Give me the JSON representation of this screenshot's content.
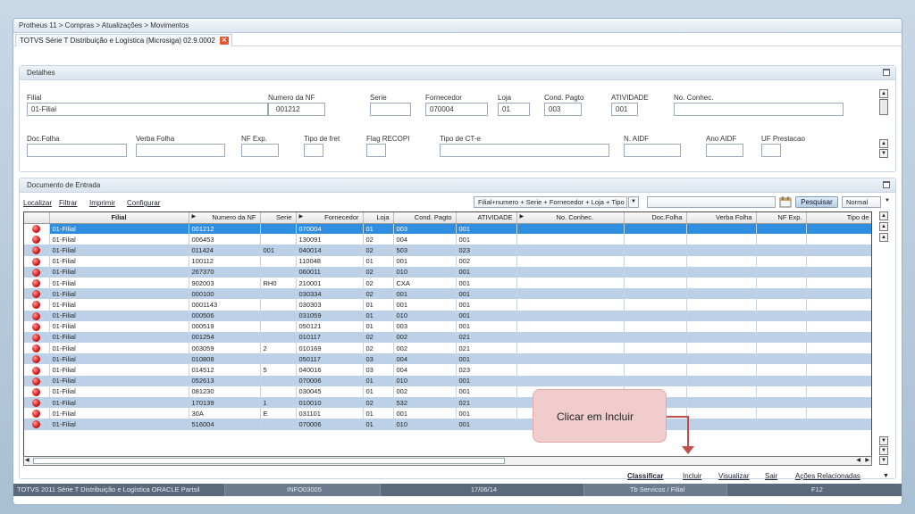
{
  "breadcrumb": "Protheus 11 > Compras  > Atualizações > Movimentos",
  "tab": {
    "label": "TOTVS Série T Distribuição e Logística (Microsiga) 02.9.0002",
    "close": "✕"
  },
  "detalhes": {
    "title": "Detalhes",
    "fields": {
      "filial": {
        "label": "Filial",
        "value": "01-Filial"
      },
      "numero_nf": {
        "label": "Numero da NF",
        "value": "001212"
      },
      "serie": {
        "label": "Serie",
        "value": ""
      },
      "fornecedor": {
        "label": "Fornecedor",
        "value": "070004"
      },
      "loja": {
        "label": "Loja",
        "value": "01"
      },
      "cond_pagto": {
        "label": "Cond. Pagto",
        "value": "003"
      },
      "atividade": {
        "label": "ATIVIDADE",
        "value": "001"
      },
      "no_conhec": {
        "label": "No. Conhec.",
        "value": ""
      },
      "doc_folha": {
        "label": "Doc.Folha",
        "value": ""
      },
      "verba_folha": {
        "label": "Verba Folha",
        "value": ""
      },
      "nf_exp": {
        "label": "NF Exp.",
        "value": ""
      },
      "tipo_fret": {
        "label": "Tipo de fret",
        "value": ""
      },
      "flag_recopi": {
        "label": "Flag RECOPI",
        "value": ""
      },
      "tipo_cte": {
        "label": "Tipo de CT-e",
        "value": ""
      },
      "n_aidf": {
        "label": "N. AIDF",
        "value": ""
      },
      "ano_aidf": {
        "label": "Ano AIDF",
        "value": ""
      },
      "uf_prestacao": {
        "label": "UF Prestacao",
        "value": ""
      }
    }
  },
  "documento": {
    "title": "Documento de Entrada",
    "links": {
      "localizar": "Localizar",
      "filtrar": "Filtrar",
      "imprimir": "Imprimir",
      "configurar": "Configurar"
    },
    "index_select": "Filial+numero + Serie + Fornecedor + Loja + Tipo",
    "search_value": "",
    "pesquisar": "Pesquisar",
    "mode_select": "Normal",
    "columns": [
      "",
      "Filial",
      "Numero da NF",
      "Serie",
      "Fornecedor",
      "Loja",
      "Cond. Pagto",
      "ATIVIDADE",
      "No. Conhec.",
      "Doc.Folha",
      "Verba Folha",
      "NF Exp.",
      "Tipo de"
    ],
    "rows": [
      [
        "01-Filial",
        "001212",
        "",
        "070004",
        "01",
        "003",
        "001"
      ],
      [
        "01-Filial",
        "006453",
        "",
        "130091",
        "02",
        "004",
        "001"
      ],
      [
        "01-Filial",
        "011424",
        "001",
        "040014",
        "02",
        "503",
        "023"
      ],
      [
        "01-Filial",
        "100112",
        "",
        "110048",
        "01",
        "001",
        "002"
      ],
      [
        "01-Filial",
        "267370",
        "",
        "060011",
        "02",
        "010",
        "001"
      ],
      [
        "01-Filial",
        "902003",
        "RH0",
        "210001",
        "02",
        "CXA",
        "001"
      ],
      [
        "01-Filial",
        "000100",
        "",
        "030334",
        "02",
        "001",
        "001"
      ],
      [
        "01-Filial",
        "0001143",
        "",
        "030303",
        "01",
        "001",
        "001"
      ],
      [
        "01-Filial",
        "000506",
        "",
        "031059",
        "01",
        "010",
        "001"
      ],
      [
        "01-Filial",
        "000519",
        "",
        "050121",
        "01",
        "003",
        "001"
      ],
      [
        "01-Filial",
        "001254",
        "",
        "010117",
        "02",
        "002",
        "021"
      ],
      [
        "01-Filial",
        "003059",
        "2",
        "010169",
        "02",
        "002",
        "021"
      ],
      [
        "01-Filial",
        "010808",
        "",
        "050117",
        "03",
        "004",
        "001"
      ],
      [
        "01-Filial",
        "014512",
        "5",
        "040016",
        "03",
        "004",
        "023"
      ],
      [
        "01-Filial",
        "052613",
        "",
        "070006",
        "01",
        "010",
        "001"
      ],
      [
        "01-Filial",
        "081230",
        "",
        "030045",
        "01",
        "002",
        "001"
      ],
      [
        "01-Filial",
        "170139",
        "1",
        "010010",
        "02",
        "532",
        "021"
      ],
      [
        "01-Filial",
        "30A",
        "E",
        "031101",
        "01",
        "001",
        "001"
      ],
      [
        "01-Filial",
        "516004",
        "",
        "070006",
        "01",
        "010",
        "001"
      ]
    ],
    "actions": {
      "classificar": "Classificar",
      "incluir": "Incluir",
      "visualizar": "Visualizar",
      "sair": "Sair",
      "acoes": "Ações Relacionadas"
    }
  },
  "status": {
    "product": "TOTVS 2011 Série T Distribuição e Logística ORACLE Partsil",
    "user": "INFO03005",
    "date": "17/06/14",
    "company": "Tb Servicos / Filial",
    "key": "F12"
  },
  "callout": "Clicar em Incluir",
  "colors": {
    "selected_row": "#2f8ee0",
    "alt_row": "#bcd1e8",
    "status_icon": "#d01515",
    "callout_bg": "#f1cccc",
    "callout_line": "#c0504d"
  }
}
